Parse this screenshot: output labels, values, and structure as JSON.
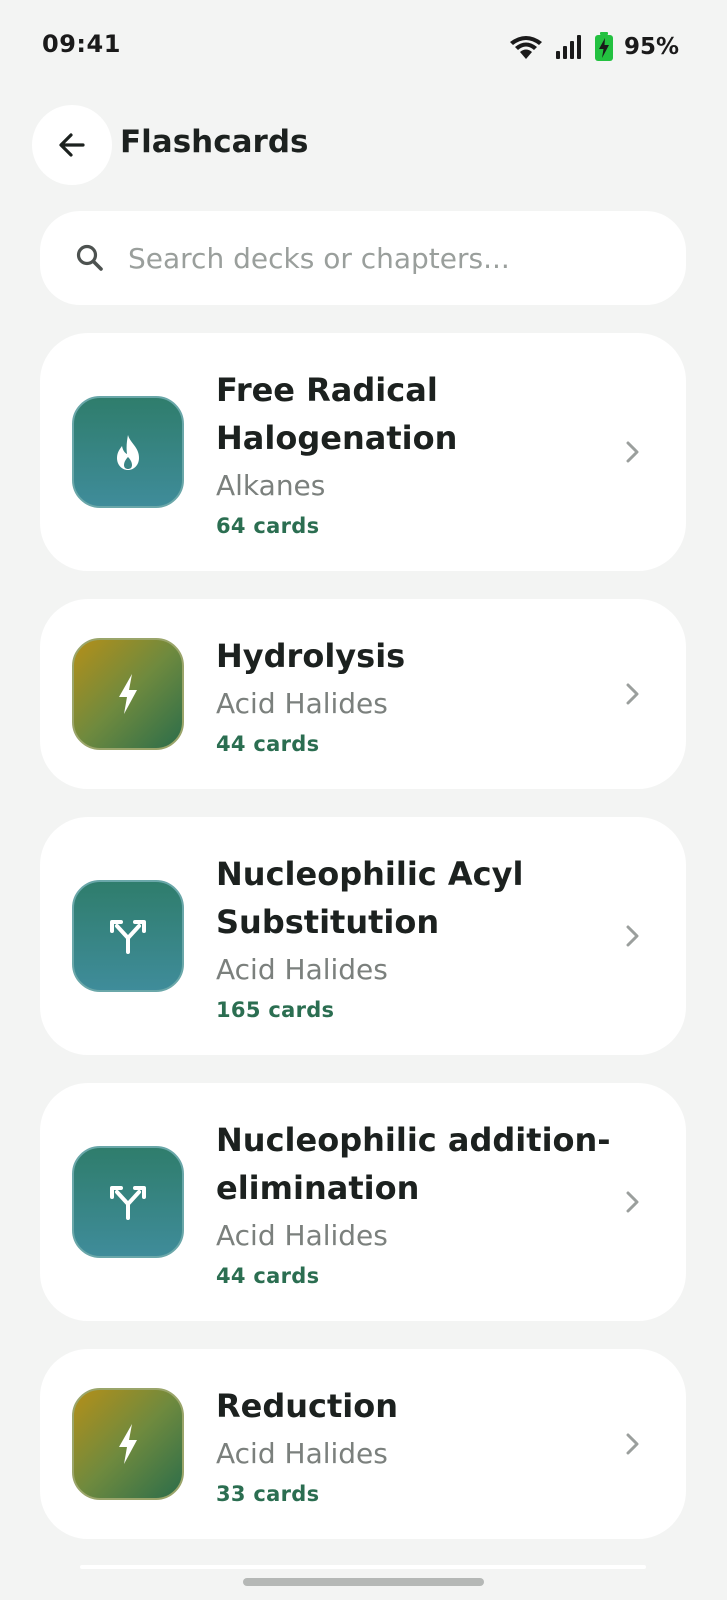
{
  "status_bar": {
    "time": "09:41",
    "battery_percent": "95%",
    "battery_level": 0.95,
    "icons": [
      "wifi-icon",
      "signal-icon",
      "battery-charging-icon"
    ]
  },
  "header": {
    "back_icon": "arrow-left-icon",
    "title": "Flashcards"
  },
  "search": {
    "placeholder": "Search decks or chapters...",
    "value": "",
    "icon": "search-icon"
  },
  "decks": [
    {
      "title": "Free Radical Halogenation",
      "chapter": "Alkanes",
      "cards": "64 cards",
      "icon": "flame-icon",
      "icon_color": "teal"
    },
    {
      "title": "Hydrolysis",
      "chapter": "Acid Halides",
      "cards": "44 cards",
      "icon": "lightning-icon",
      "icon_color": "amber"
    },
    {
      "title": "Nucleophilic Acyl Substitution",
      "chapter": "Acid Halides",
      "cards": "165 cards",
      "icon": "split-arrow-icon",
      "icon_color": "teal"
    },
    {
      "title": "Nucleophilic addition-elimination",
      "chapter": "Acid Halides",
      "cards": "44 cards",
      "icon": "split-arrow-icon",
      "icon_color": "teal"
    },
    {
      "title": "Reduction",
      "chapter": "Acid Halides",
      "cards": "33 cards",
      "icon": "lightning-icon",
      "icon_color": "amber"
    }
  ],
  "colors": {
    "background": "#f3f4f3",
    "card": "#ffffff",
    "accent_green": "#2b6e51",
    "teal_icon": "#3a8585",
    "amber_icon": "#b48f19"
  }
}
